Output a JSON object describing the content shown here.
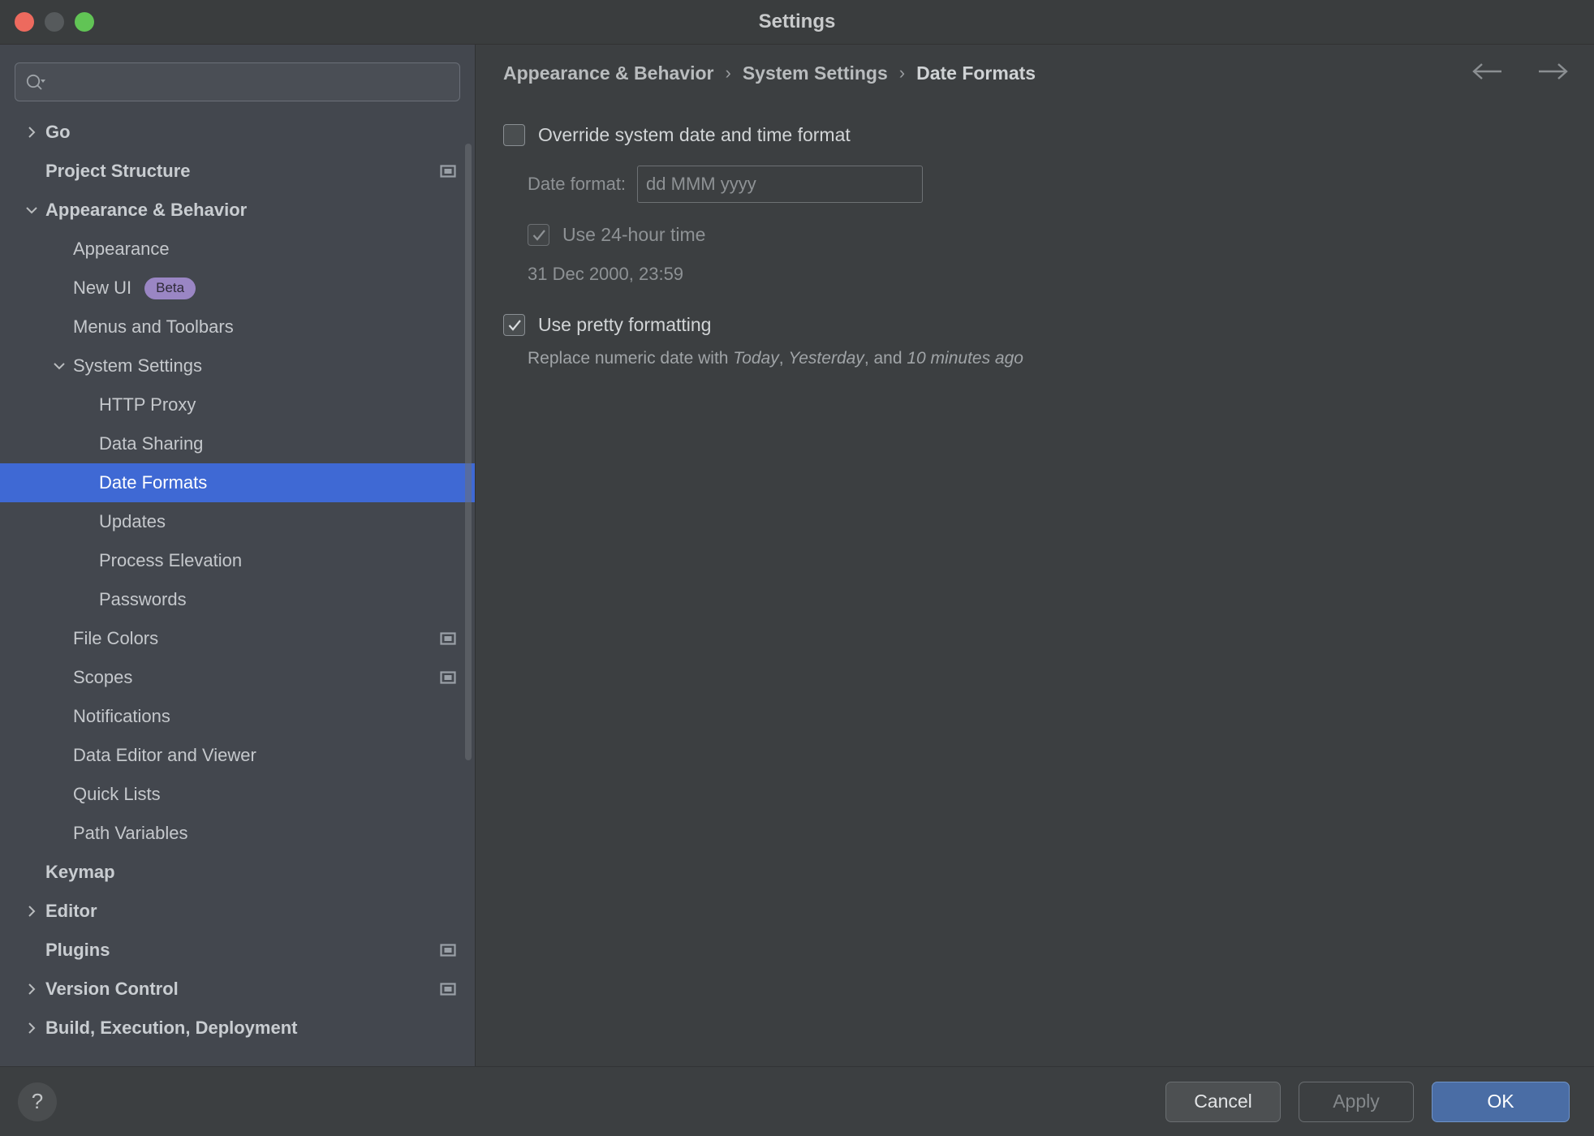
{
  "window": {
    "title": "Settings",
    "traffic_lights": [
      "close-button",
      "minimize-button",
      "zoom-button"
    ]
  },
  "sidebar": {
    "search": {
      "value": "",
      "placeholder": "",
      "icon": "search-icon"
    },
    "items": [
      {
        "label": "Go",
        "indent": 0,
        "bold": true,
        "twisty": "collapsed",
        "badge": null,
        "scope_icon": false,
        "selected": false
      },
      {
        "label": "Project Structure",
        "indent": 0,
        "bold": true,
        "twisty": "none",
        "badge": null,
        "scope_icon": true,
        "selected": false
      },
      {
        "label": "Appearance & Behavior",
        "indent": 0,
        "bold": true,
        "twisty": "expanded",
        "badge": null,
        "scope_icon": false,
        "selected": false
      },
      {
        "label": "Appearance",
        "indent": 1,
        "bold": false,
        "twisty": "none",
        "badge": null,
        "scope_icon": false,
        "selected": false
      },
      {
        "label": "New UI",
        "indent": 1,
        "bold": false,
        "twisty": "none",
        "badge": "Beta",
        "scope_icon": false,
        "selected": false
      },
      {
        "label": "Menus and Toolbars",
        "indent": 1,
        "bold": false,
        "twisty": "none",
        "badge": null,
        "scope_icon": false,
        "selected": false
      },
      {
        "label": "System Settings",
        "indent": 1,
        "bold": false,
        "twisty": "expanded",
        "badge": null,
        "scope_icon": false,
        "selected": false
      },
      {
        "label": "HTTP Proxy",
        "indent": 2,
        "bold": false,
        "twisty": "none",
        "badge": null,
        "scope_icon": false,
        "selected": false
      },
      {
        "label": "Data Sharing",
        "indent": 2,
        "bold": false,
        "twisty": "none",
        "badge": null,
        "scope_icon": false,
        "selected": false
      },
      {
        "label": "Date Formats",
        "indent": 2,
        "bold": false,
        "twisty": "none",
        "badge": null,
        "scope_icon": false,
        "selected": true
      },
      {
        "label": "Updates",
        "indent": 2,
        "bold": false,
        "twisty": "none",
        "badge": null,
        "scope_icon": false,
        "selected": false
      },
      {
        "label": "Process Elevation",
        "indent": 2,
        "bold": false,
        "twisty": "none",
        "badge": null,
        "scope_icon": false,
        "selected": false
      },
      {
        "label": "Passwords",
        "indent": 2,
        "bold": false,
        "twisty": "none",
        "badge": null,
        "scope_icon": false,
        "selected": false
      },
      {
        "label": "File Colors",
        "indent": 1,
        "bold": false,
        "twisty": "none",
        "badge": null,
        "scope_icon": true,
        "selected": false
      },
      {
        "label": "Scopes",
        "indent": 1,
        "bold": false,
        "twisty": "none",
        "badge": null,
        "scope_icon": true,
        "selected": false
      },
      {
        "label": "Notifications",
        "indent": 1,
        "bold": false,
        "twisty": "none",
        "badge": null,
        "scope_icon": false,
        "selected": false
      },
      {
        "label": "Data Editor and Viewer",
        "indent": 1,
        "bold": false,
        "twisty": "none",
        "badge": null,
        "scope_icon": false,
        "selected": false
      },
      {
        "label": "Quick Lists",
        "indent": 1,
        "bold": false,
        "twisty": "none",
        "badge": null,
        "scope_icon": false,
        "selected": false
      },
      {
        "label": "Path Variables",
        "indent": 1,
        "bold": false,
        "twisty": "none",
        "badge": null,
        "scope_icon": false,
        "selected": false
      },
      {
        "label": "Keymap",
        "indent": 0,
        "bold": true,
        "twisty": "none",
        "badge": null,
        "scope_icon": false,
        "selected": false
      },
      {
        "label": "Editor",
        "indent": 0,
        "bold": true,
        "twisty": "collapsed",
        "badge": null,
        "scope_icon": false,
        "selected": false
      },
      {
        "label": "Plugins",
        "indent": 0,
        "bold": true,
        "twisty": "none",
        "badge": null,
        "scope_icon": true,
        "selected": false
      },
      {
        "label": "Version Control",
        "indent": 0,
        "bold": true,
        "twisty": "collapsed",
        "badge": null,
        "scope_icon": true,
        "selected": false
      },
      {
        "label": "Build, Execution, Deployment",
        "indent": 0,
        "bold": true,
        "twisty": "collapsed",
        "badge": null,
        "scope_icon": false,
        "selected": false
      }
    ]
  },
  "main": {
    "breadcrumb": [
      "Appearance & Behavior",
      "System Settings",
      "Date Formats"
    ],
    "breadcrumb_separator": "›",
    "nav": {
      "back_icon": "arrow-left-icon",
      "forward_icon": "arrow-right-icon"
    },
    "override": {
      "label": "Override system date and time format",
      "checked": false,
      "enabled": true
    },
    "date_format": {
      "label": "Date format:",
      "value": "",
      "placeholder": "dd MMM yyyy",
      "enabled": false
    },
    "use_24h": {
      "label": "Use 24-hour time",
      "checked": true,
      "enabled": false
    },
    "preview": "31 Dec 2000, 23:59",
    "pretty": {
      "label": "Use pretty formatting",
      "checked": true,
      "enabled": true
    },
    "pretty_desc": {
      "prefix": "Replace numeric date with ",
      "item1": "Today",
      "sep1": ", ",
      "item2": "Yesterday",
      "sep2": ", and ",
      "item3": "10 minutes ago"
    }
  },
  "footer": {
    "help": "?",
    "cancel": "Cancel",
    "apply": "Apply",
    "ok": "OK"
  },
  "colors": {
    "sidebar_bg": "#43474e",
    "main_bg": "#3c3f41",
    "selection": "#3f69d4",
    "badge_bg": "#9a86c4",
    "ok_button": "#4a6da5"
  }
}
